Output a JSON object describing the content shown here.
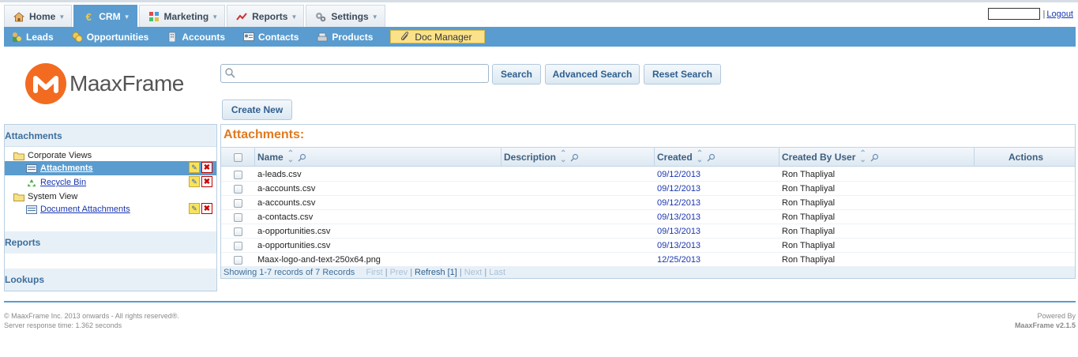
{
  "top_nav": {
    "tabs": [
      {
        "label": "Home",
        "icon": "home-icon",
        "active": false
      },
      {
        "label": "CRM",
        "icon": "euro-icon",
        "active": true
      },
      {
        "label": "Marketing",
        "icon": "marketing-icon",
        "active": false
      },
      {
        "label": "Reports",
        "icon": "chart-icon",
        "active": false
      },
      {
        "label": "Settings",
        "icon": "gears-icon",
        "active": false
      }
    ],
    "logout_label": "Logout"
  },
  "sub_nav": {
    "items": [
      {
        "label": "Leads",
        "icon": "leads-icon"
      },
      {
        "label": "Opportunities",
        "icon": "coins-icon"
      },
      {
        "label": "Accounts",
        "icon": "building-icon"
      },
      {
        "label": "Contacts",
        "icon": "contact-card-icon"
      },
      {
        "label": "Products",
        "icon": "products-icon"
      },
      {
        "label": "Doc Manager",
        "icon": "paperclip-icon",
        "active": true
      }
    ]
  },
  "logo": {
    "text": "MaaxFrame"
  },
  "search": {
    "placeholder": "",
    "search_label": "Search",
    "advanced_label": "Advanced Search",
    "reset_label": "Reset Search",
    "create_label": "Create New"
  },
  "left_panel": {
    "header": "Attachments",
    "groups": [
      {
        "label": "Corporate Views",
        "items": [
          {
            "label": "Attachments",
            "selected": true
          },
          {
            "label": "Recycle Bin",
            "selected": false
          }
        ]
      },
      {
        "label": "System View",
        "items": [
          {
            "label": "Document Attachments",
            "selected": false
          }
        ]
      }
    ],
    "sections": [
      "Reports",
      "Lookups"
    ]
  },
  "grid": {
    "title": "Attachments:",
    "columns": [
      "Name",
      "Description",
      "Created",
      "Created By User",
      "Actions"
    ],
    "rows": [
      {
        "name": "a-leads.csv",
        "description": "",
        "created": "09/12/2013",
        "user": "Ron Thapliyal"
      },
      {
        "name": "a-accounts.csv",
        "description": "",
        "created": "09/12/2013",
        "user": "Ron Thapliyal"
      },
      {
        "name": "a-accounts.csv",
        "description": "",
        "created": "09/12/2013",
        "user": "Ron Thapliyal"
      },
      {
        "name": "a-contacts.csv",
        "description": "",
        "created": "09/13/2013",
        "user": "Ron Thapliyal"
      },
      {
        "name": "a-opportunities.csv",
        "description": "",
        "created": "09/13/2013",
        "user": "Ron Thapliyal"
      },
      {
        "name": "a-opportunities.csv",
        "description": "",
        "created": "09/13/2013",
        "user": "Ron Thapliyal"
      },
      {
        "name": "Maax-logo-and-text-250x64.png",
        "description": "",
        "created": "12/25/2013",
        "user": "Ron Thapliyal"
      }
    ],
    "footer": {
      "showing": "Showing 1-7 records of 7 Records",
      "first": "First",
      "prev": "Prev",
      "refresh": "Refresh [1]",
      "next": "Next",
      "last": "Last"
    }
  },
  "footer": {
    "copyright": "© MaaxFrame Inc. 2013 onwards - All rights reserved®.",
    "response": "Server response time: 1.362 seconds",
    "powered_by": "Powered By",
    "version": "MaaxFrame v2.1.5"
  },
  "colors": {
    "accent": "#5a9ccf",
    "title_orange": "#e07a1f",
    "logo_orange": "#f26b21",
    "link": "#1a36b0"
  }
}
